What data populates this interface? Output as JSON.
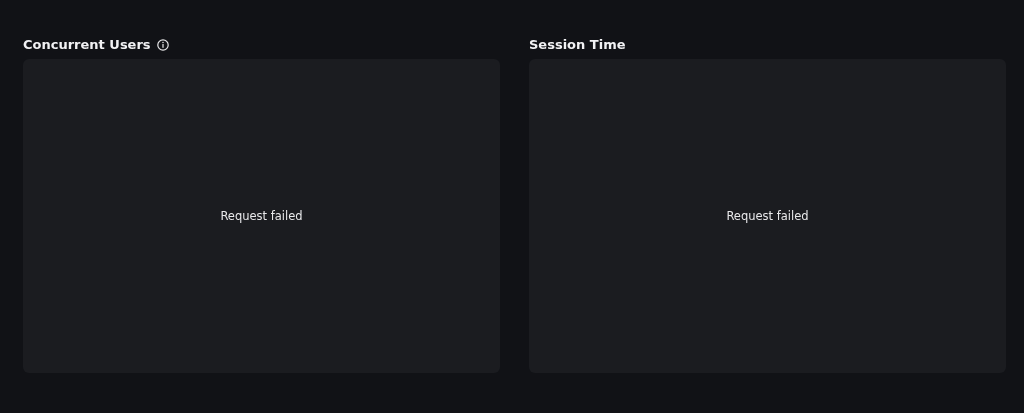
{
  "panels": [
    {
      "title": "Concurrent Users",
      "info_icon": true,
      "message": "Request failed"
    },
    {
      "title": "Session Time",
      "info_icon": false,
      "message": "Request failed"
    }
  ]
}
